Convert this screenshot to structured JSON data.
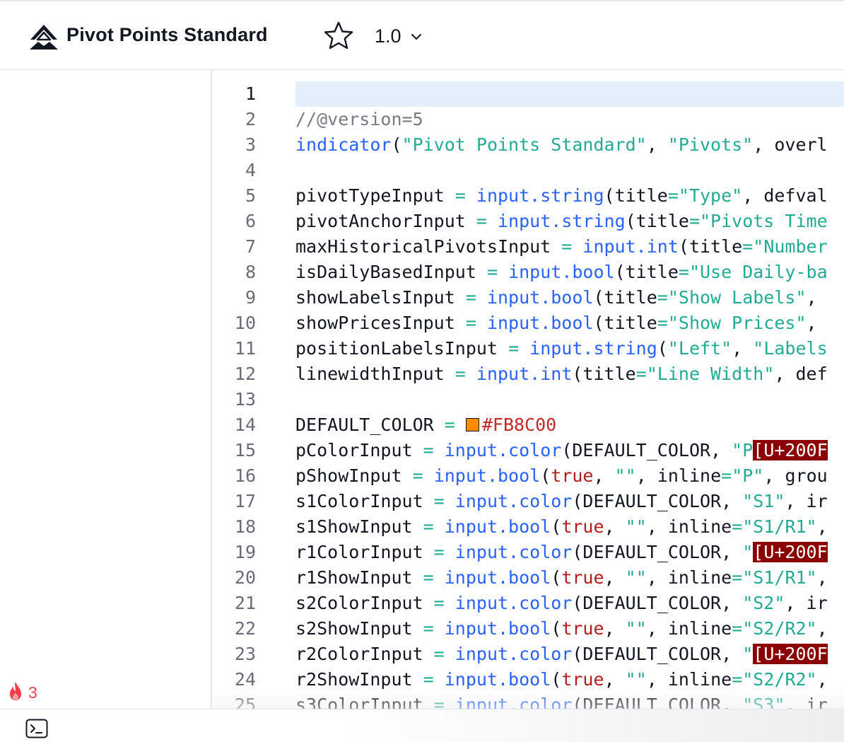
{
  "header": {
    "title": "Pivot Points Standard",
    "version": "1.0",
    "logo_icon": "mountain-logo-icon",
    "star_icon": "star-icon",
    "chevron_icon": "chevron-down-icon"
  },
  "sidebar": {
    "boost_icon": "fire-icon",
    "boost_count": "3"
  },
  "bottombar": {
    "console_icon": "terminal-icon"
  },
  "colors": {
    "accent_blue": "#2962ff",
    "string_green": "#22ab94",
    "keyword_red": "#b71c1c",
    "current_line": "#e3effa",
    "swatch_orange": "#FB8C00",
    "error_bg": "#8b0000"
  },
  "editor": {
    "current_line": 1,
    "lines": [
      {
        "n": "1",
        "segments": []
      },
      {
        "n": "2",
        "segments": [
          [
            "c-comment",
            "//@version=5"
          ]
        ]
      },
      {
        "n": "3",
        "segments": [
          [
            "c-fn",
            "indicator"
          ],
          [
            "c-plain",
            "("
          ],
          [
            "c-str",
            "\"Pivot Points Standard\""
          ],
          [
            "c-plain",
            ", "
          ],
          [
            "c-str",
            "\"Pivots\""
          ],
          [
            "c-plain",
            ", overl"
          ]
        ]
      },
      {
        "n": "4",
        "segments": []
      },
      {
        "n": "5",
        "segments": [
          [
            "c-plain",
            "pivotTypeInput "
          ],
          [
            "c-op",
            "="
          ],
          [
            "c-plain",
            " "
          ],
          [
            "c-fn",
            "input.string"
          ],
          [
            "c-plain",
            "(title"
          ],
          [
            "c-op",
            "="
          ],
          [
            "c-str",
            "\"Type\""
          ],
          [
            "c-plain",
            ", defval"
          ]
        ]
      },
      {
        "n": "6",
        "segments": [
          [
            "c-plain",
            "pivotAnchorInput "
          ],
          [
            "c-op",
            "="
          ],
          [
            "c-plain",
            " "
          ],
          [
            "c-fn",
            "input.string"
          ],
          [
            "c-plain",
            "(title"
          ],
          [
            "c-op",
            "="
          ],
          [
            "c-str",
            "\"Pivots Time"
          ]
        ]
      },
      {
        "n": "7",
        "segments": [
          [
            "c-plain",
            "maxHistoricalPivotsInput "
          ],
          [
            "c-op",
            "="
          ],
          [
            "c-plain",
            " "
          ],
          [
            "c-fn",
            "input.int"
          ],
          [
            "c-plain",
            "(title"
          ],
          [
            "c-op",
            "="
          ],
          [
            "c-str",
            "\"Number"
          ]
        ]
      },
      {
        "n": "8",
        "segments": [
          [
            "c-plain",
            "isDailyBasedInput "
          ],
          [
            "c-op",
            "="
          ],
          [
            "c-plain",
            " "
          ],
          [
            "c-fn",
            "input.bool"
          ],
          [
            "c-plain",
            "(title"
          ],
          [
            "c-op",
            "="
          ],
          [
            "c-str",
            "\"Use Daily-ba"
          ]
        ]
      },
      {
        "n": "9",
        "segments": [
          [
            "c-plain",
            "showLabelsInput "
          ],
          [
            "c-op",
            "="
          ],
          [
            "c-plain",
            " "
          ],
          [
            "c-fn",
            "input.bool"
          ],
          [
            "c-plain",
            "(title"
          ],
          [
            "c-op",
            "="
          ],
          [
            "c-str",
            "\"Show Labels\""
          ],
          [
            "c-plain",
            ","
          ]
        ]
      },
      {
        "n": "10",
        "segments": [
          [
            "c-plain",
            "showPricesInput "
          ],
          [
            "c-op",
            "="
          ],
          [
            "c-plain",
            " "
          ],
          [
            "c-fn",
            "input.bool"
          ],
          [
            "c-plain",
            "(title"
          ],
          [
            "c-op",
            "="
          ],
          [
            "c-str",
            "\"Show Prices\""
          ],
          [
            "c-plain",
            ","
          ]
        ]
      },
      {
        "n": "11",
        "segments": [
          [
            "c-plain",
            "positionLabelsInput "
          ],
          [
            "c-op",
            "="
          ],
          [
            "c-plain",
            " "
          ],
          [
            "c-fn",
            "input.string"
          ],
          [
            "c-plain",
            "("
          ],
          [
            "c-str",
            "\"Left\""
          ],
          [
            "c-plain",
            ", "
          ],
          [
            "c-str",
            "\"Labels"
          ]
        ]
      },
      {
        "n": "12",
        "segments": [
          [
            "c-plain",
            "linewidthInput "
          ],
          [
            "c-op",
            "="
          ],
          [
            "c-plain",
            " "
          ],
          [
            "c-fn",
            "input.int"
          ],
          [
            "c-plain",
            "(title"
          ],
          [
            "c-op",
            "="
          ],
          [
            "c-str",
            "\"Line Width\""
          ],
          [
            "c-plain",
            ", def"
          ]
        ]
      },
      {
        "n": "13",
        "segments": []
      },
      {
        "n": "14",
        "segments": [
          [
            "c-plain",
            "DEFAULT_COLOR "
          ],
          [
            "c-op",
            "="
          ],
          [
            "c-plain",
            " "
          ],
          [
            "swatch",
            "#FB8C00"
          ],
          [
            "c-hex",
            "#FB8C00"
          ]
        ]
      },
      {
        "n": "15",
        "segments": [
          [
            "c-plain",
            "pColorInput "
          ],
          [
            "c-op",
            "="
          ],
          [
            "c-plain",
            " "
          ],
          [
            "c-fn",
            "input.color"
          ],
          [
            "c-plain",
            "(DEFAULT_COLOR, "
          ],
          [
            "c-str",
            "\"P"
          ],
          [
            "c-err",
            "[U+200F"
          ]
        ]
      },
      {
        "n": "16",
        "segments": [
          [
            "c-plain",
            "pShowInput "
          ],
          [
            "c-op",
            "="
          ],
          [
            "c-plain",
            " "
          ],
          [
            "c-fn",
            "input.bool"
          ],
          [
            "c-plain",
            "("
          ],
          [
            "c-kw",
            "true"
          ],
          [
            "c-plain",
            ", "
          ],
          [
            "c-str",
            "\"\""
          ],
          [
            "c-plain",
            ", inline"
          ],
          [
            "c-op",
            "="
          ],
          [
            "c-str",
            "\"P\""
          ],
          [
            "c-plain",
            ", grou"
          ]
        ]
      },
      {
        "n": "17",
        "segments": [
          [
            "c-plain",
            "s1ColorInput "
          ],
          [
            "c-op",
            "="
          ],
          [
            "c-plain",
            " "
          ],
          [
            "c-fn",
            "input.color"
          ],
          [
            "c-plain",
            "(DEFAULT_COLOR, "
          ],
          [
            "c-str",
            "\"S1\""
          ],
          [
            "c-plain",
            ", ir"
          ]
        ]
      },
      {
        "n": "18",
        "segments": [
          [
            "c-plain",
            "s1ShowInput "
          ],
          [
            "c-op",
            "="
          ],
          [
            "c-plain",
            " "
          ],
          [
            "c-fn",
            "input.bool"
          ],
          [
            "c-plain",
            "("
          ],
          [
            "c-kw",
            "true"
          ],
          [
            "c-plain",
            ", "
          ],
          [
            "c-str",
            "\"\""
          ],
          [
            "c-plain",
            ", inline"
          ],
          [
            "c-op",
            "="
          ],
          [
            "c-str",
            "\"S1/R1\""
          ],
          [
            "c-plain",
            ","
          ]
        ]
      },
      {
        "n": "19",
        "segments": [
          [
            "c-plain",
            "r1ColorInput "
          ],
          [
            "c-op",
            "="
          ],
          [
            "c-plain",
            " "
          ],
          [
            "c-fn",
            "input.color"
          ],
          [
            "c-plain",
            "(DEFAULT_COLOR, "
          ],
          [
            "c-str",
            "\""
          ],
          [
            "c-err",
            "[U+200F"
          ]
        ]
      },
      {
        "n": "20",
        "segments": [
          [
            "c-plain",
            "r1ShowInput "
          ],
          [
            "c-op",
            "="
          ],
          [
            "c-plain",
            " "
          ],
          [
            "c-fn",
            "input.bool"
          ],
          [
            "c-plain",
            "("
          ],
          [
            "c-kw",
            "true"
          ],
          [
            "c-plain",
            ", "
          ],
          [
            "c-str",
            "\"\""
          ],
          [
            "c-plain",
            ", inline"
          ],
          [
            "c-op",
            "="
          ],
          [
            "c-str",
            "\"S1/R1\""
          ],
          [
            "c-plain",
            ","
          ]
        ]
      },
      {
        "n": "21",
        "segments": [
          [
            "c-plain",
            "s2ColorInput "
          ],
          [
            "c-op",
            "="
          ],
          [
            "c-plain",
            " "
          ],
          [
            "c-fn",
            "input.color"
          ],
          [
            "c-plain",
            "(DEFAULT_COLOR, "
          ],
          [
            "c-str",
            "\"S2\""
          ],
          [
            "c-plain",
            ", ir"
          ]
        ]
      },
      {
        "n": "22",
        "segments": [
          [
            "c-plain",
            "s2ShowInput "
          ],
          [
            "c-op",
            "="
          ],
          [
            "c-plain",
            " "
          ],
          [
            "c-fn",
            "input.bool"
          ],
          [
            "c-plain",
            "("
          ],
          [
            "c-kw",
            "true"
          ],
          [
            "c-plain",
            ", "
          ],
          [
            "c-str",
            "\"\""
          ],
          [
            "c-plain",
            ", inline"
          ],
          [
            "c-op",
            "="
          ],
          [
            "c-str",
            "\"S2/R2\""
          ],
          [
            "c-plain",
            ","
          ]
        ]
      },
      {
        "n": "23",
        "segments": [
          [
            "c-plain",
            "r2ColorInput "
          ],
          [
            "c-op",
            "="
          ],
          [
            "c-plain",
            " "
          ],
          [
            "c-fn",
            "input.color"
          ],
          [
            "c-plain",
            "(DEFAULT_COLOR, "
          ],
          [
            "c-str",
            "\""
          ],
          [
            "c-err",
            "[U+200F"
          ]
        ]
      },
      {
        "n": "24",
        "segments": [
          [
            "c-plain",
            "r2ShowInput "
          ],
          [
            "c-op",
            "="
          ],
          [
            "c-plain",
            " "
          ],
          [
            "c-fn",
            "input.bool"
          ],
          [
            "c-plain",
            "("
          ],
          [
            "c-kw",
            "true"
          ],
          [
            "c-plain",
            ", "
          ],
          [
            "c-str",
            "\"\""
          ],
          [
            "c-plain",
            ", inline"
          ],
          [
            "c-op",
            "="
          ],
          [
            "c-str",
            "\"S2/R2\""
          ],
          [
            "c-plain",
            ","
          ]
        ]
      },
      {
        "n": "25",
        "segments": [
          [
            "c-plain",
            "s3ColorInput "
          ],
          [
            "c-op",
            "="
          ],
          [
            "c-plain",
            " "
          ],
          [
            "c-fn",
            "input.color"
          ],
          [
            "c-plain",
            "(DEFAULT_COLOR, "
          ],
          [
            "c-str",
            "\"S3\""
          ],
          [
            "c-plain",
            ", ir"
          ]
        ]
      }
    ]
  }
}
